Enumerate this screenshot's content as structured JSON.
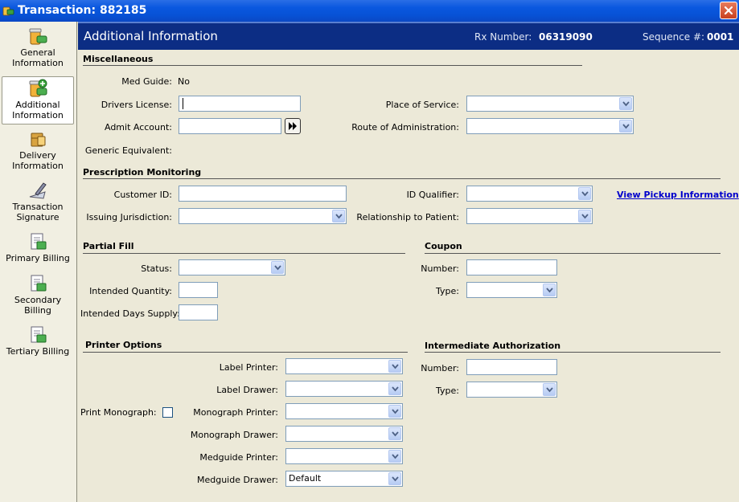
{
  "window": {
    "title": "Transaction: 882185"
  },
  "sidebar": {
    "items": [
      {
        "label": "General Information",
        "line1": "General",
        "line2": "Information"
      },
      {
        "label": "Additional Information",
        "line1": "Additional",
        "line2": "Information"
      },
      {
        "label": "Delivery Information",
        "line1": "Delivery",
        "line2": "Information"
      },
      {
        "label": "Transaction Signature",
        "line1": "Transaction",
        "line2": "Signature"
      },
      {
        "label": "Primary Billing",
        "line1": "Primary Billing",
        "line2": ""
      },
      {
        "label": "Secondary Billing",
        "line1": "Secondary",
        "line2": "Billing"
      },
      {
        "label": "Tertiary Billing",
        "line1": "Tertiary Billing",
        "line2": ""
      }
    ]
  },
  "header": {
    "title": "Additional Information",
    "rx_label": "Rx Number:",
    "rx_value": "06319090",
    "seq_label": "Sequence #:",
    "seq_value": "0001"
  },
  "misc": {
    "heading": "Miscellaneous",
    "med_guide_label": "Med Guide:",
    "med_guide_value": "No",
    "drivers_license_label": "Drivers License:",
    "drivers_license_value": "",
    "admit_account_label": "Admit Account:",
    "admit_account_value": "",
    "generic_equivalent_label": "Generic Equivalent:",
    "place_of_service_label": "Place of Service:",
    "place_of_service_value": "",
    "route_label": "Route of Administration:",
    "route_value": ""
  },
  "pmp": {
    "heading": "Prescription Monitoring",
    "customer_id_label": "Customer ID:",
    "customer_id_value": "",
    "issuing_label": "Issuing Jurisdiction:",
    "issuing_value": "",
    "id_qualifier_label": "ID Qualifier:",
    "id_qualifier_value": "",
    "relationship_label": "Relationship to Patient:",
    "relationship_value": "",
    "view_pickup_link": "View Pickup Information"
  },
  "partial_fill": {
    "heading": "Partial Fill",
    "status_label": "Status:",
    "status_value": "",
    "qty_label": "Intended Quantity:",
    "qty_value": "",
    "days_label": "Intended Days Supply:",
    "days_value": ""
  },
  "coupon": {
    "heading": "Coupon",
    "number_label": "Number:",
    "number_value": "",
    "type_label": "Type:",
    "type_value": ""
  },
  "printer": {
    "heading": "Printer Options",
    "print_monograph_label": "Print Monograph:",
    "print_monograph_checked": false,
    "label_printer_label": "Label Printer:",
    "label_printer_value": "",
    "label_drawer_label": "Label Drawer:",
    "label_drawer_value": "",
    "monograph_printer_label": "Monograph Printer:",
    "monograph_printer_value": "",
    "monograph_drawer_label": "Monograph Drawer:",
    "monograph_drawer_value": "",
    "medguide_printer_label": "Medguide Printer:",
    "medguide_printer_value": "",
    "medguide_drawer_label": "Medguide Drawer:",
    "medguide_drawer_value": "Default"
  },
  "intermediate": {
    "heading": "Intermediate Authorization",
    "number_label": "Number:",
    "number_value": "",
    "type_label": "Type:",
    "type_value": ""
  },
  "colors": {
    "header_bg": "#0c2d84",
    "link": "#0000cc",
    "titlebar": "#0a58df"
  }
}
